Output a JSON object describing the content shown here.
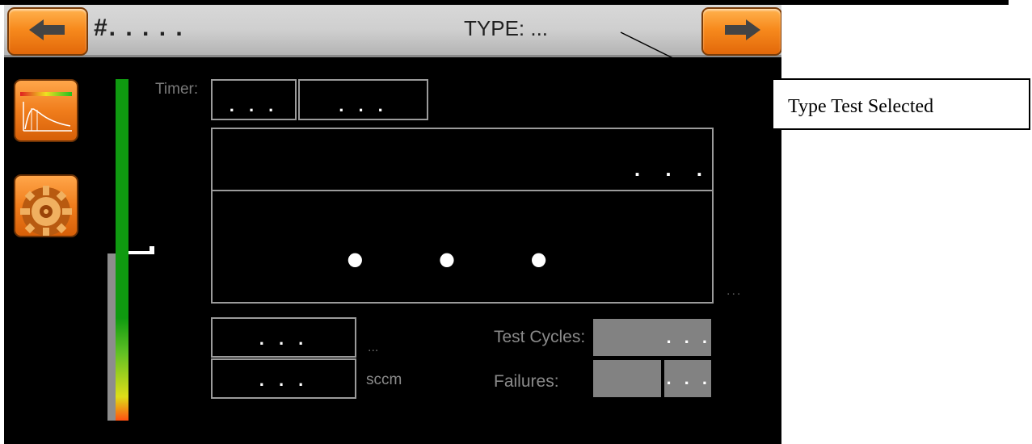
{
  "header": {
    "back_icon": "arrow-left-icon",
    "next_icon": "arrow-right-icon",
    "title_number": "#. .  . . .",
    "title_type": "TYPE: ..."
  },
  "sidebar": {
    "graph_icon": "graph-icon",
    "settings_icon": "gear-icon"
  },
  "level_bar": {
    "level_fraction": 0.49
  },
  "timer": {
    "label": "Timer:",
    "value1": ". . .",
    "value2": ". . ."
  },
  "display": {
    "top_value": ". . .",
    "main_value": "• • •",
    "unit": "..."
  },
  "readouts": [
    {
      "value": ". . .",
      "unit": "..."
    },
    {
      "value": ". . .",
      "unit": "sccm"
    }
  ],
  "stats": {
    "test_cycles_label": "Test Cycles:",
    "test_cycles_value": ". . .",
    "failures_label": "Failures:",
    "failures_value": ". . ."
  },
  "annotation": {
    "text": "Type Test Selected"
  },
  "colors": {
    "button_orange": "#f78a1d",
    "bar_green": "#0f9a10",
    "screen_bg": "#000000"
  }
}
